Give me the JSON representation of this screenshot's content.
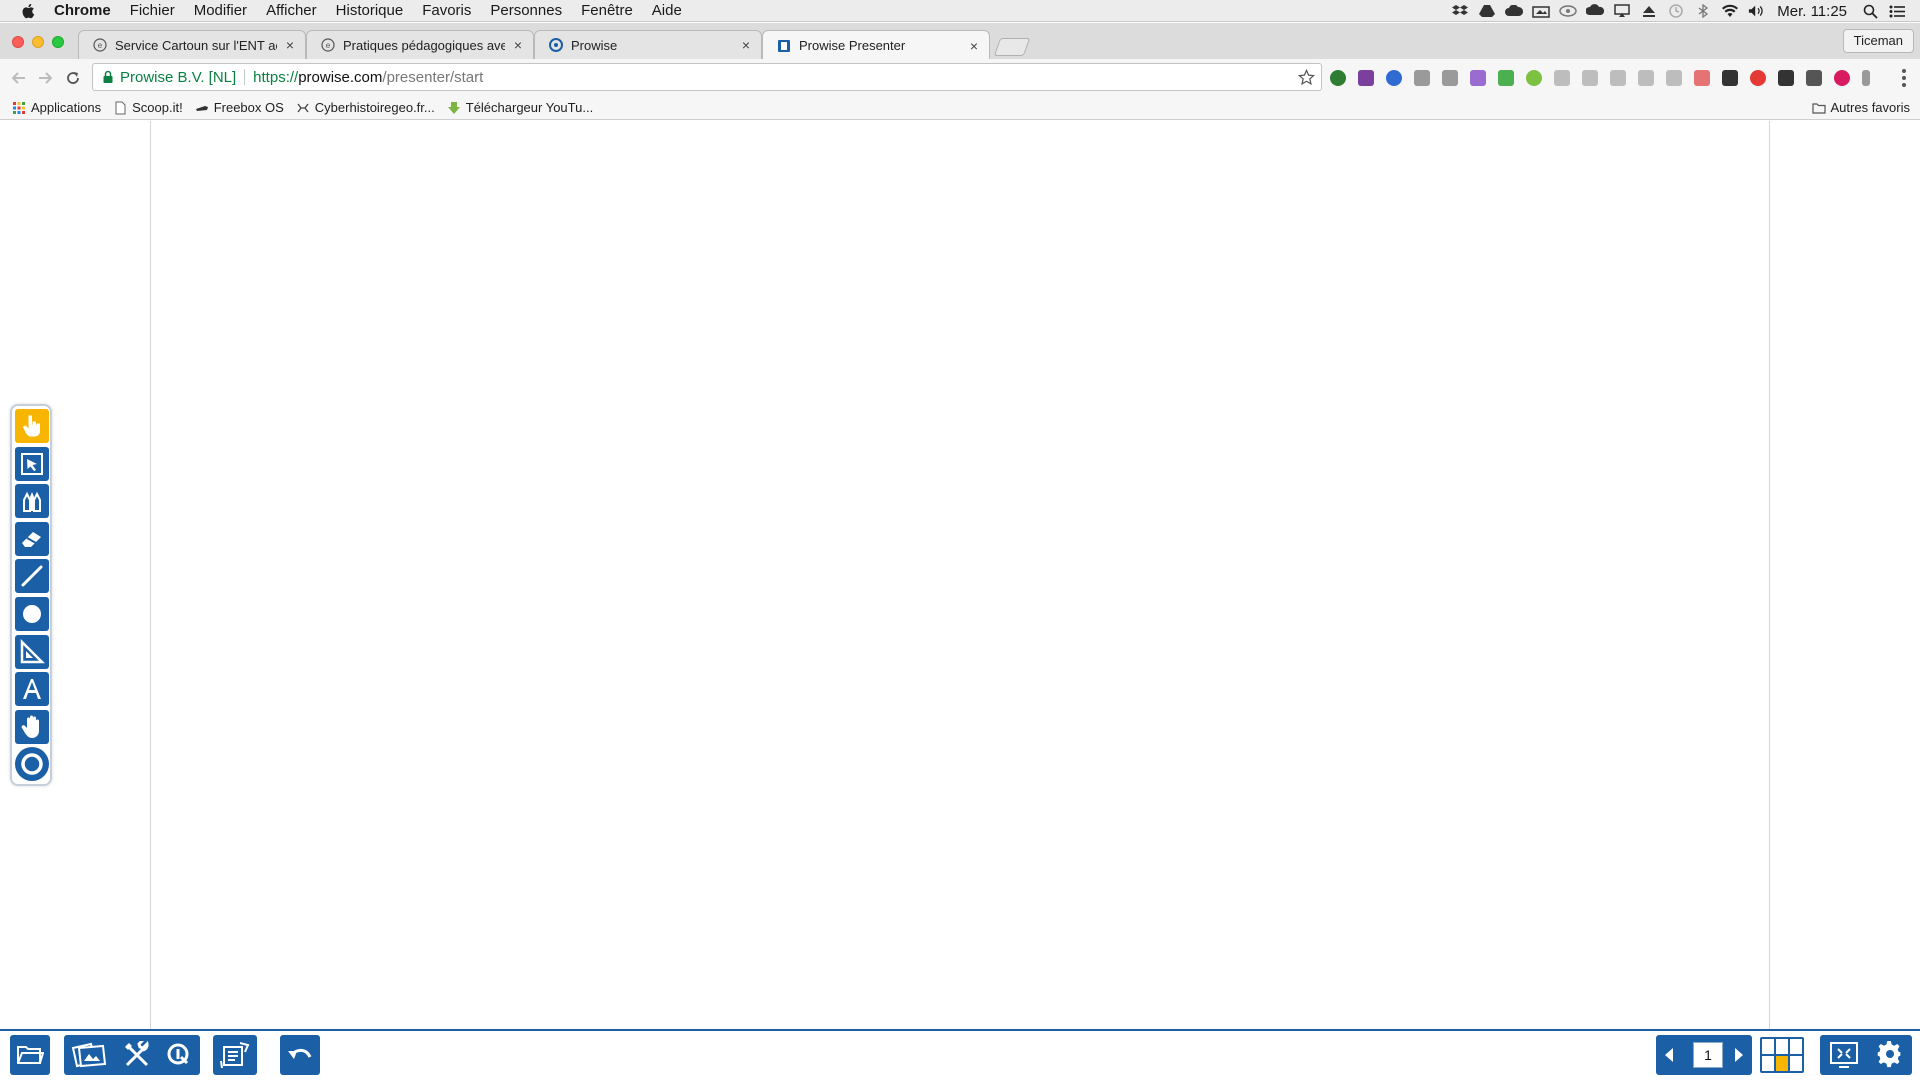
{
  "menubar": {
    "app_name": "Chrome",
    "items": [
      "Fichier",
      "Modifier",
      "Afficher",
      "Historique",
      "Favoris",
      "Personnes",
      "Fenêtre",
      "Aide"
    ],
    "clock": "Mer. 11:25",
    "status_icons": [
      "dropbox-icon",
      "drive-icon",
      "cloud-icon",
      "screenshot-icon",
      "sync-icon",
      "creative-cloud-icon",
      "airplay-icon",
      "eject-icon",
      "time-machine-icon",
      "bluetooth-icon",
      "wifi-icon",
      "volume-icon",
      "spotlight-icon",
      "notification-center-icon"
    ]
  },
  "tabs": [
    {
      "label": "Service Cartoun sur l'ENT aca",
      "favicon": "globe-icon",
      "active": false
    },
    {
      "label": "Pratiques pédagogiques avec l",
      "favicon": "globe-icon",
      "active": false
    },
    {
      "label": "Prowise",
      "favicon": "prowise-icon",
      "active": false
    },
    {
      "label": "Prowise Presenter",
      "favicon": "prowise-presenter-icon",
      "active": true
    }
  ],
  "profile_name": "Ticeman",
  "omnibox": {
    "secure_label": "Prowise B.V. [NL]",
    "url_scheme": "https://",
    "url_host": "prowise.com",
    "url_path": "/presenter/start"
  },
  "extensions": [
    {
      "name": "ext-green-icon",
      "color": "#2e7d32"
    },
    {
      "name": "ext-onenote-icon",
      "color": "#7b3f9e"
    },
    {
      "name": "ext-k-icon",
      "color": "#2f6bd1"
    },
    {
      "name": "ext-grey-1-icon",
      "color": "#9a9a9a"
    },
    {
      "name": "ext-camera-icon",
      "color": "#9a9a9a"
    },
    {
      "name": "ext-pen-icon",
      "color": "#9a6bd1"
    },
    {
      "name": "ext-evernote-icon",
      "color": "#4caf50"
    },
    {
      "name": "ext-dot-icon",
      "color": "#7cc142"
    },
    {
      "name": "ext-grey-2-icon",
      "color": "#bdbdbd"
    },
    {
      "name": "ext-grey-3-icon",
      "color": "#bdbdbd"
    },
    {
      "name": "ext-n-icon",
      "color": "#bdbdbd"
    },
    {
      "name": "ext-grey-4-icon",
      "color": "#bdbdbd"
    },
    {
      "name": "ext-rss-icon",
      "color": "#bdbdbd"
    },
    {
      "name": "ext-link-icon",
      "color": "#e57373"
    },
    {
      "name": "ext-qr-1-icon",
      "color": "#333333"
    },
    {
      "name": "ext-opera-icon",
      "color": "#e53935"
    },
    {
      "name": "ext-qr-2-icon",
      "color": "#333333"
    },
    {
      "name": "ext-box-icon",
      "color": "#555555"
    },
    {
      "name": "ext-pocket-icon",
      "color": "#d81b60"
    },
    {
      "name": "ext-pin-icon",
      "color": "#9a9a9a"
    }
  ],
  "bookmarks": [
    {
      "label": "Applications",
      "icon": "apps-grid-icon"
    },
    {
      "label": "Scoop.it!",
      "icon": "page-icon"
    },
    {
      "label": "Freebox OS",
      "icon": "freebox-icon"
    },
    {
      "label": "Cyberhistoiregeo.fr...",
      "icon": "cyber-icon"
    },
    {
      "label": "Téléchargeur YouTu...",
      "icon": "download-arrow-icon"
    }
  ],
  "bookmarks_other": "Autres favoris",
  "palette_tools": [
    {
      "name": "pointer-hand-tool",
      "active": true
    },
    {
      "name": "select-tool",
      "active": false
    },
    {
      "name": "pens-tool",
      "active": false
    },
    {
      "name": "eraser-tool",
      "active": false
    },
    {
      "name": "line-tool",
      "active": false
    },
    {
      "name": "shape-tool",
      "active": false
    },
    {
      "name": "ruler-tool",
      "active": false
    },
    {
      "name": "text-tool",
      "active": false
    },
    {
      "name": "pan-hand-tool",
      "active": false
    },
    {
      "name": "circle-menu-tool",
      "active": false
    }
  ],
  "bottom": {
    "page_number": "1"
  },
  "colors": {
    "prowise_blue": "#1b5fa6",
    "active_yellow": "#f7b500",
    "secure_green": "#0b8043"
  }
}
